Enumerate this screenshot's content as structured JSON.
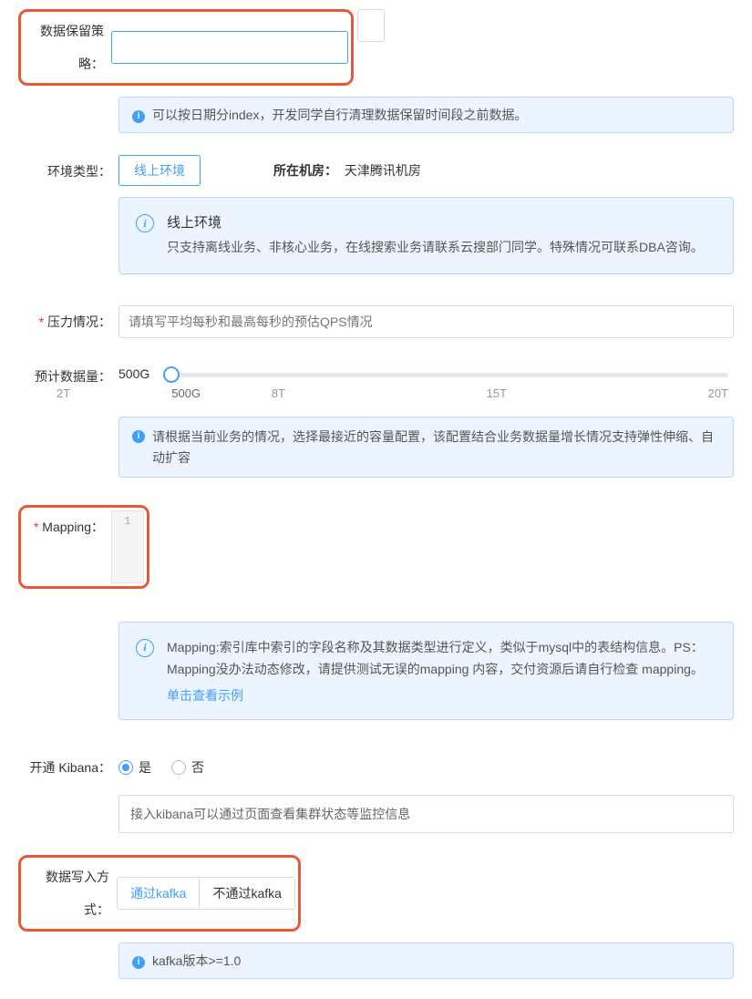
{
  "fields": {
    "retention": {
      "label": "数据保留策略：",
      "value": "",
      "info": "可以按日期分index，开发同学自行清理数据保留时间段之前数据。"
    },
    "env": {
      "label": "环境类型：",
      "selected": "线上环境",
      "location_label": "所在机房：",
      "location_value": "天津腾讯机房",
      "callout_title": "线上环境",
      "callout_body": "只支持离线业务、非核心业务，在线搜索业务请联系云搜部门同学。特殊情况可联系DBA咨询。"
    },
    "qps": {
      "label": "压力情况：",
      "placeholder": "请填写平均每秒和最高每秒的预估QPS情况"
    },
    "datasize": {
      "label": "预计数据量：",
      "value": "500G",
      "ticks": [
        "500G",
        "2T",
        "8T",
        "15T",
        "20T"
      ],
      "info": "请根据当前业务的情况，选择最接近的容量配置，该配置结合业务数据量增长情况支持弹性伸缩、自动扩容"
    },
    "mapping": {
      "label": "Mapping：",
      "line_no": "1",
      "callout_body": "Mapping:索引库中索引的字段名称及其数据类型进行定义，类似于mysql中的表结构信息。PS：Mapping没办法动态修改，请提供测试无误的mapping 内容，交付资源后请自行检查 mapping。",
      "link": "单击查看示例"
    },
    "kibana": {
      "label": "开通 Kibana：",
      "options": {
        "yes": "是",
        "no": "否"
      },
      "selected": "yes",
      "info": "接入kibana可以通过页面查看集群状态等监控信息"
    },
    "write_mode": {
      "label": "数据写入方式：",
      "options": {
        "via": "通过kafka",
        "not_via": "不通过kafka"
      },
      "selected": "via",
      "info": "kafka版本>=1.0"
    }
  }
}
